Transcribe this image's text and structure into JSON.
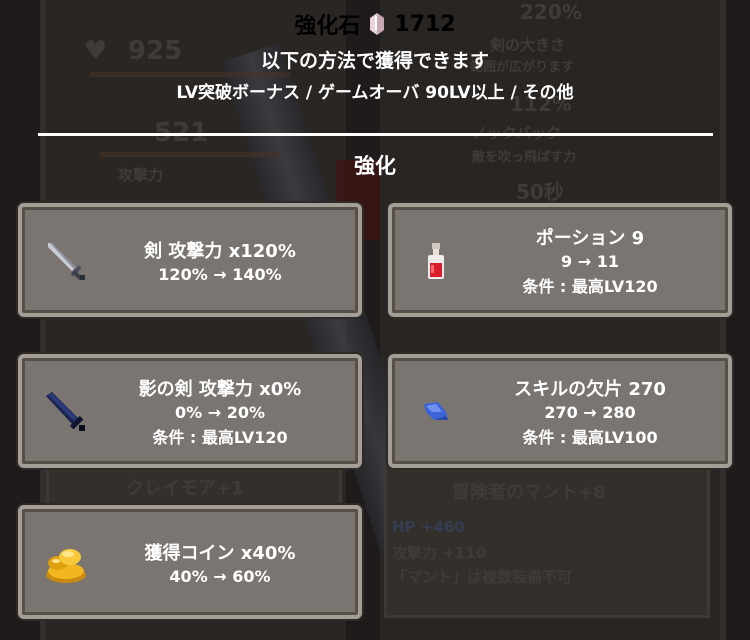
{
  "header": {
    "currency_name": "強化石",
    "currency_amount": "1712",
    "subtitle": "以下の方法で獲得できます",
    "sources": "LV突破ボーナス / ゲームオーバ 90LV以上 / その他"
  },
  "section_title": "強化",
  "cards": [
    {
      "name": "剣 攻撃力 x120%",
      "change": "120% → 140%",
      "condition": "",
      "icon": "sword-icon"
    },
    {
      "name": "ポーション 9",
      "change": "9 → 11",
      "condition": "条件 : 最高LV120",
      "icon": "potion-icon"
    },
    {
      "name": "影の剣 攻撃力 x0%",
      "change": "0% → 20%",
      "condition": "条件 : 最高LV120",
      "icon": "shadow-sword-icon"
    },
    {
      "name": "スキルの欠片 270",
      "change": "270 → 280",
      "condition": "条件 : 最高LV100",
      "icon": "skill-fragment-icon"
    },
    {
      "name": "獲得コイン x40%",
      "change": "40% → 60%",
      "condition": "",
      "icon": "coin-stack-icon"
    }
  ],
  "background": {
    "hp_value": "925",
    "attack_value": "521",
    "attack_label": "攻撃力",
    "size_pct": "220%",
    "size_label": "剣の大きさ",
    "size_desc": "範囲が広がります",
    "knockback_value": "112%",
    "knockback_label": "ノックバック",
    "knockback_desc": "敵を吹っ飛ばす力",
    "time_value": "50秒",
    "weapon_name": "クレイモア+1",
    "cape_name": "冒険者のマント+8",
    "cape_hp": "HP +460",
    "cape_attack": "攻撃力 +110",
    "cape_note": "「マント」は複数装備不可"
  }
}
